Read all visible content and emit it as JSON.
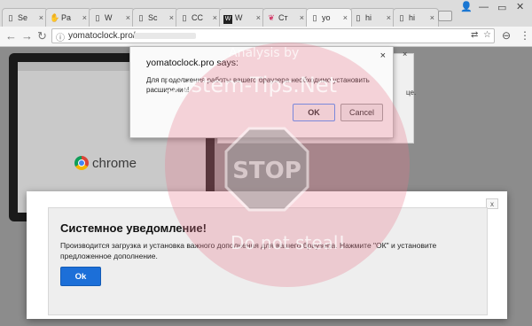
{
  "tabs": [
    {
      "favicon": "doc-icon",
      "title": "Se"
    },
    {
      "favicon": "hand-icon",
      "title": "Pa"
    },
    {
      "favicon": "doc-icon",
      "title": "W"
    },
    {
      "favicon": "doc-icon",
      "title": "Sc"
    },
    {
      "favicon": "doc-icon",
      "title": "CC"
    },
    {
      "favicon": "w-logo-icon",
      "title": "W"
    },
    {
      "favicon": "heart-icon",
      "title": "Ст"
    },
    {
      "favicon": "doc-icon",
      "title": "yo"
    },
    {
      "favicon": "doc-icon",
      "title": "hi"
    },
    {
      "favicon": "doc-icon",
      "title": "hi"
    }
  ],
  "address_bar": {
    "url": "yomatoclock.pro/"
  },
  "background_page": {
    "brand": "chrome",
    "partial_text": "це."
  },
  "js_alert": {
    "title": "yomatoclock.pro says:",
    "message": "Для продолжения работы вашего браузера необходимо установить расширение!",
    "ok_label": "OK",
    "cancel_label": "Cancel",
    "close_glyph": "×"
  },
  "system_notice": {
    "title": "Системное уведомление!",
    "body": "Производится загрузка и установка важного дополнения для вашего браузера. Нажмите \"ОК\" и установите предложенное дополнение.",
    "ok_label": "Ok",
    "close_glyph": "x"
  },
  "watermark": {
    "line1": "Analysis by",
    "line2": "System-Tips.Net",
    "stop": "STOP",
    "line3": "Do not steal!"
  },
  "colors": {
    "notice_button": "#1c6fd8",
    "alert_ok_border": "#4d90fe",
    "watermark": "#e8788c"
  }
}
